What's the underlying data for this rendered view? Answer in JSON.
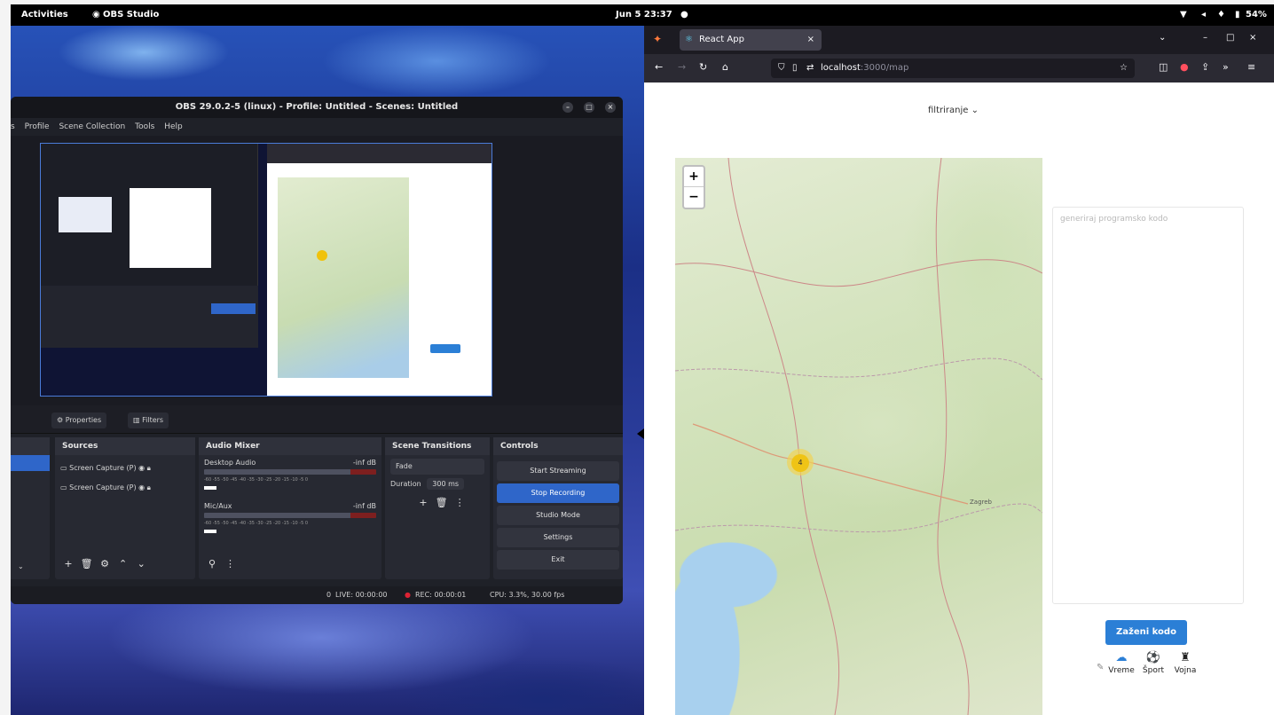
{
  "topbar": {
    "activities": "Activities",
    "app_name": "OBS Studio",
    "clock": "Jun 5 23:37",
    "battery": "54%"
  },
  "obs": {
    "title": "OBS 29.0.2-5 (linux) - Profile: Untitled - Scenes: Untitled",
    "menu": [
      "s",
      "Profile",
      "Scene Collection",
      "Tools",
      "Help"
    ],
    "tabs": {
      "properties": "Properties",
      "filters": "Filters"
    },
    "sources": {
      "title": "Sources",
      "items": [
        "Screen Capture (P)",
        "Screen Capture (P)"
      ]
    },
    "audio_mixer": {
      "title": "Audio Mixer",
      "channels": [
        {
          "name": "Desktop Audio",
          "level": "-inf dB"
        },
        {
          "name": "Mic/Aux",
          "level": "-inf dB"
        }
      ],
      "scale": "-60 -55 -50 -45 -40 -35 -30 -25 -20 -15 -10 -5 0"
    },
    "transitions": {
      "title": "Scene Transitions",
      "type": "Fade",
      "duration_label": "Duration",
      "duration_value": "300 ms"
    },
    "controls": {
      "title": "Controls",
      "buttons": [
        "Start Streaming",
        "Stop Recording",
        "Studio Mode",
        "Settings",
        "Exit"
      ]
    },
    "status": {
      "dropped": "0",
      "live": "LIVE: 00:00:00",
      "rec": "REC: 00:00:01",
      "cpu": "CPU: 3.3%, 30.00 fps"
    }
  },
  "browser": {
    "tab_title": "React App",
    "url_host": "localhost",
    "url_path": ":3000/map",
    "dropdown": "filtriranje",
    "textarea_placeholder": "generiraj programsko kodo",
    "run_button": "Zaženi kodo",
    "categories": [
      {
        "label": "Vreme",
        "icon": "cloud-icon"
      },
      {
        "label": "Šport",
        "icon": "ball-icon"
      },
      {
        "label": "Vojna",
        "icon": "soldier-icon"
      }
    ],
    "map": {
      "zoom_in": "+",
      "zoom_out": "−",
      "cluster_count": "4",
      "city_labels": [
        "Zagreb"
      ]
    }
  },
  "colors": {
    "accent": "#2b7fd6",
    "obs_active": "#2f66c9",
    "cluster": "#f0c20c"
  }
}
